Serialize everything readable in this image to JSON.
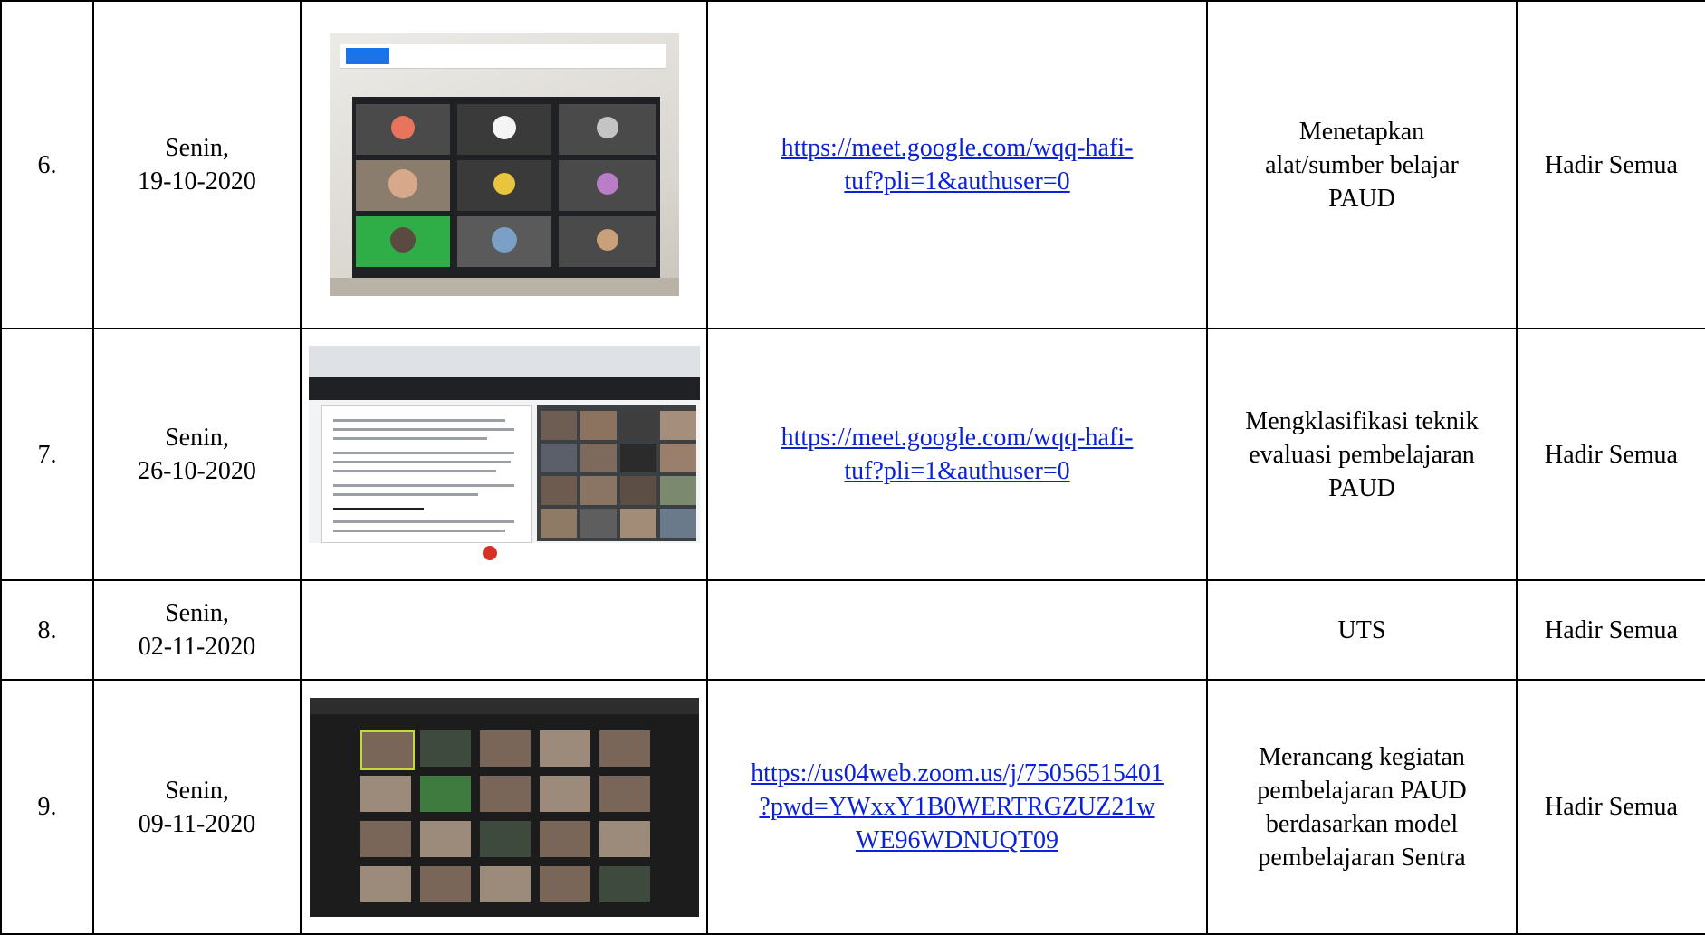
{
  "rows": [
    {
      "no": "6.",
      "day": "Senin,",
      "date": "19-10-2020",
      "screenshot_icon": "laptop-google-meet-photo",
      "link_line1": "https://meet.google.com/wqq-hafi-",
      "link_line2": "tuf?pli=1&authuser=0",
      "link_line3": "",
      "material_lines": [
        "Menetapkan",
        "alat/sumber belajar",
        "PAUD"
      ],
      "attendance": "Hadir Semua"
    },
    {
      "no": "7.",
      "day": "Senin,",
      "date": "26-10-2020",
      "screenshot_icon": "google-meet-presentation-screenshot",
      "link_line1": "https://meet.google.com/wqq-hafi-",
      "link_line2": "tuf?pli=1&authuser=0",
      "link_line3": "",
      "material_lines": [
        "Mengklasifikasi teknik",
        "evaluasi pembelajaran",
        "PAUD"
      ],
      "attendance": "Hadir Semua"
    },
    {
      "no": "8.",
      "day": "Senin,",
      "date": "02-11-2020",
      "screenshot_icon": "",
      "link_line1": "",
      "link_line2": "",
      "link_line3": "",
      "material_lines": [
        "UTS"
      ],
      "attendance": "Hadir Semua"
    },
    {
      "no": "9.",
      "day": "Senin,",
      "date": "09-11-2020",
      "screenshot_icon": "zoom-meeting-gallery-screenshot",
      "link_line1": "https://us04web.zoom.us/j/75056515401",
      "link_line2": "?pwd=YWxxY1B0WERTRGZUZ21w",
      "link_line3": "WE96WDNUQT09",
      "material_lines": [
        "Merancang kegiatan",
        "pembelajaran PAUD",
        "berdasarkan model",
        "pembelajaran Sentra"
      ],
      "attendance": "Hadir Semua"
    }
  ],
  "colors": {
    "link": "#0b22d8",
    "border": "#000000"
  }
}
